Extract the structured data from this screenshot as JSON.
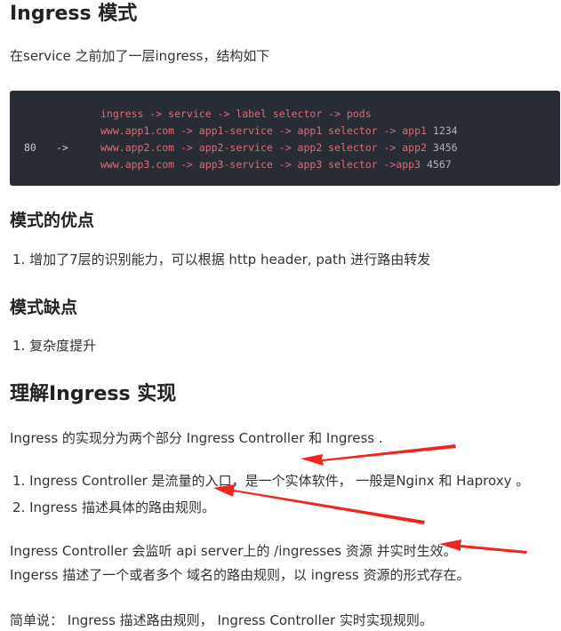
{
  "title": "Ingress 模式",
  "intro": "在service 之前加了一层ingress，结构如下",
  "code": {
    "port": "80",
    "arrow": "->",
    "line1": "ingress -> service -> label selector -> pods",
    "line2": "www.app1.com -> app1-service -> app1 selector -> app1",
    "line2_port": "1234",
    "line3": "www.app2.com -> app2-service -> app2 selector -> app2",
    "line3_port": "3456",
    "line4": "www.app3.com -> app3-service -> app3 selector ->app3",
    "line4_port": "4567"
  },
  "pros": {
    "heading": "模式的优点",
    "items": [
      "增加了7层的识别能力，可以根据 http header, path 进行路由转发"
    ]
  },
  "cons": {
    "heading": "模式缺点",
    "items": [
      "复杂度提升"
    ]
  },
  "impl": {
    "heading": "理解Ingress 实现",
    "intro": "Ingress 的实现分为两个部分 Ingress Controller 和 Ingress .",
    "items": [
      "Ingress Controller 是流量的入口，是一个实体软件， 一般是Nginx 和 Haproxy 。",
      "Ingress 描述具体的路由规则。"
    ],
    "para1": "Ingress Controller 会监听 api server上的 /ingresses 资源 并实时生效。",
    "para2": "Ingerss 描述了一个或者多个 域名的路由规则，以 ingress 资源的形式存在。",
    "summary": "简单说： Ingress 描述路由规则， Ingress Controller 实时实现规则。"
  },
  "colors": {
    "annotation_arrow": "#f0251e",
    "code_bg": "#282c34",
    "code_keyword": "#e06c75"
  }
}
